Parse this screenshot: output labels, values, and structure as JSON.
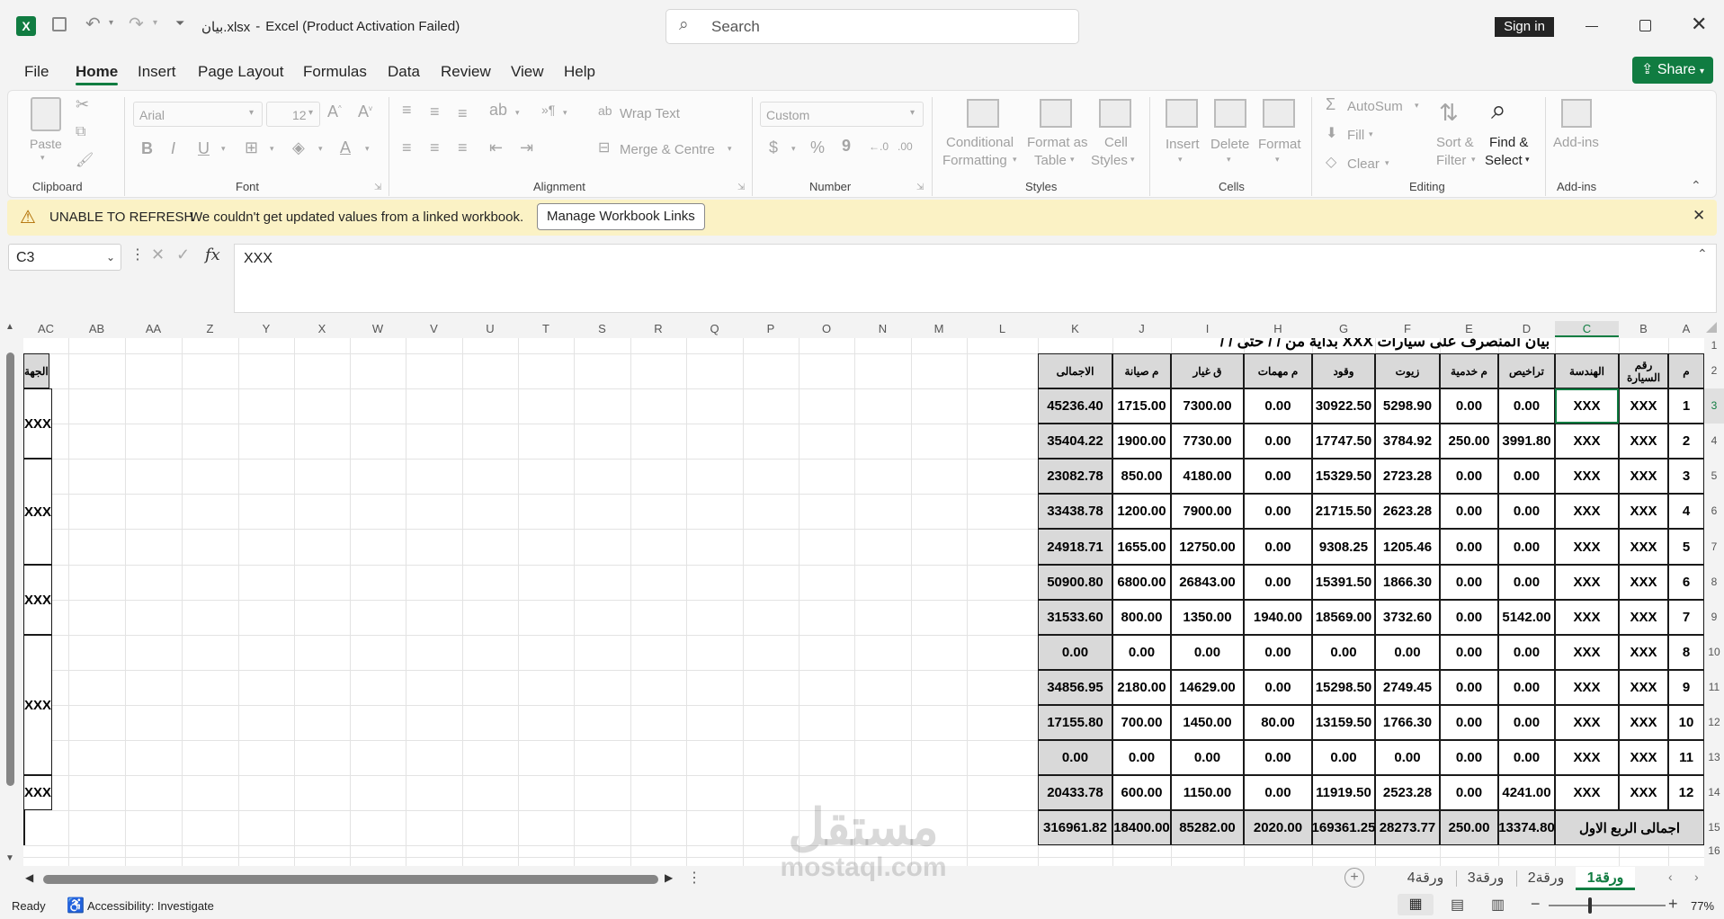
{
  "titlebar": {
    "filename": "بيان.xlsx",
    "separator": "-",
    "app_status": "Excel (Product Activation Failed)",
    "search_placeholder": "Search",
    "sign_in": "Sign in"
  },
  "menu": {
    "items": [
      "File",
      "Home",
      "Insert",
      "Page Layout",
      "Formulas",
      "Data",
      "Review",
      "View",
      "Help"
    ],
    "active": "Home",
    "share": "Share"
  },
  "ribbon": {
    "clipboard": {
      "paste": "Paste",
      "label": "Clipboard"
    },
    "font": {
      "name": "Arial",
      "size": "12",
      "label": "Font"
    },
    "alignment": {
      "wrap": "Wrap Text",
      "merge": "Merge & Centre",
      "label": "Alignment"
    },
    "number": {
      "format": "Custom",
      "label": "Number"
    },
    "styles": {
      "cond1": "Conditional",
      "cond2": "Formatting",
      "fat1": "Format as",
      "fat2": "Table",
      "cs1": "Cell",
      "cs2": "Styles",
      "label": "Styles"
    },
    "cells": {
      "insert": "Insert",
      "delete": "Delete",
      "format": "Format",
      "label": "Cells"
    },
    "editing": {
      "autosum": "AutoSum",
      "fill": "Fill",
      "clear": "Clear",
      "sort1": "Sort &",
      "sort2": "Filter",
      "find1": "Find &",
      "find2": "Select",
      "label": "Editing"
    },
    "addins": {
      "addins": "Add-ins",
      "label": "Add-ins"
    }
  },
  "warning": {
    "title": "UNABLE TO REFRESH",
    "message": "We couldn't get updated values from a linked workbook.",
    "button": "Manage Workbook Links"
  },
  "formula": {
    "name_box": "C3",
    "fx": "fx",
    "value": "XXX"
  },
  "columns": [
    "AC",
    "AB",
    "AA",
    "Z",
    "Y",
    "X",
    "W",
    "V",
    "U",
    "T",
    "S",
    "R",
    "Q",
    "P",
    "O",
    "N",
    "M",
    "L",
    "K",
    "J",
    "I",
    "H",
    "G",
    "F",
    "E",
    "D",
    "C",
    "B",
    "A"
  ],
  "rows": [
    "1",
    "2",
    "3",
    "4",
    "5",
    "6",
    "7",
    "8",
    "9",
    "10",
    "11",
    "12",
    "13",
    "14",
    "15",
    "16"
  ],
  "table": {
    "title_fragment": "بيان المنصرف على سيارات XXX بداية من / / حتى / /",
    "headers": [
      "م",
      "رقم السيارة",
      "الهندسة",
      "تراخيص",
      "م خدمية",
      "زيوت",
      "وقود",
      "م مهمات",
      "ق غيار",
      "م صيانة",
      "الاجمالى",
      "الجهة"
    ],
    "rows": [
      [
        "1",
        "XXX",
        "XXX",
        "0.00",
        "0.00",
        "5298.90",
        "30922.50",
        "0.00",
        "7300.00",
        "1715.00",
        "45236.40"
      ],
      [
        "2",
        "XXX",
        "XXX",
        "3991.80",
        "250.00",
        "3784.92",
        "17747.50",
        "0.00",
        "7730.00",
        "1900.00",
        "35404.22"
      ],
      [
        "3",
        "XXX",
        "XXX",
        "0.00",
        "0.00",
        "2723.28",
        "15329.50",
        "0.00",
        "4180.00",
        "850.00",
        "23082.78"
      ],
      [
        "4",
        "XXX",
        "XXX",
        "0.00",
        "0.00",
        "2623.28",
        "21715.50",
        "0.00",
        "7900.00",
        "1200.00",
        "33438.78"
      ],
      [
        "5",
        "XXX",
        "XXX",
        "0.00",
        "0.00",
        "1205.46",
        "9308.25",
        "0.00",
        "12750.00",
        "1655.00",
        "24918.71"
      ],
      [
        "6",
        "XXX",
        "XXX",
        "0.00",
        "0.00",
        "1866.30",
        "15391.50",
        "0.00",
        "26843.00",
        "6800.00",
        "50900.80"
      ],
      [
        "7",
        "XXX",
        "XXX",
        "5142.00",
        "0.00",
        "3732.60",
        "18569.00",
        "1940.00",
        "1350.00",
        "800.00",
        "31533.60"
      ],
      [
        "8",
        "XXX",
        "XXX",
        "0.00",
        "0.00",
        "0.00",
        "0.00",
        "0.00",
        "0.00",
        "0.00",
        "0.00"
      ],
      [
        "9",
        "XXX",
        "XXX",
        "0.00",
        "0.00",
        "2749.45",
        "15298.50",
        "0.00",
        "14629.00",
        "2180.00",
        "34856.95"
      ],
      [
        "10",
        "XXX",
        "XXX",
        "0.00",
        "0.00",
        "1766.30",
        "13159.50",
        "80.00",
        "1450.00",
        "700.00",
        "17155.80"
      ],
      [
        "11",
        "XXX",
        "XXX",
        "0.00",
        "0.00",
        "0.00",
        "0.00",
        "0.00",
        "0.00",
        "0.00",
        "0.00"
      ],
      [
        "12",
        "XXX",
        "XXX",
        "4241.00",
        "0.00",
        "2523.28",
        "11919.50",
        "0.00",
        "1150.00",
        "600.00",
        "20433.78"
      ]
    ],
    "groups": [
      "XXX",
      "XXX",
      "XXX",
      "XXX",
      "XXX"
    ],
    "total_label": "اجمالى الربع الاول",
    "totals": [
      "13374.80",
      "250.00",
      "28273.77",
      "169361.25",
      "2020.00",
      "85282.00",
      "18400.00",
      "316961.82"
    ]
  },
  "sheets": [
    "ورقة1",
    "ورقة2",
    "ورقة3",
    "ورقة4"
  ],
  "active_sheet": "ورقة1",
  "status": {
    "ready": "Ready",
    "accessibility": "Accessibility: Investigate",
    "zoom": "77%"
  },
  "watermark": {
    "ar": "مستقل",
    "en": "mostaql.com"
  }
}
